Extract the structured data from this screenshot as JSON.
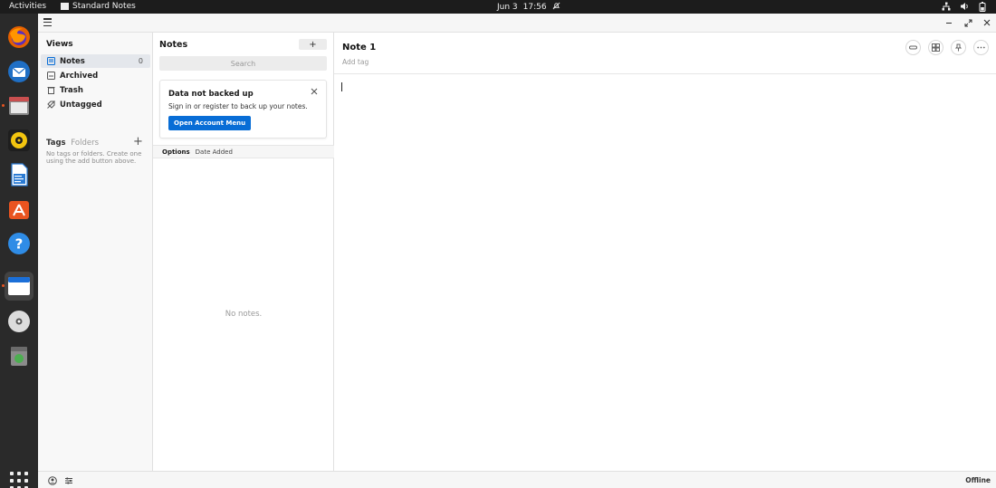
{
  "topbar": {
    "activities": "Activities",
    "app_name": "Standard Notes",
    "date": "Jun 3",
    "time": "17:56"
  },
  "dock": {
    "items": [
      "firefox-icon",
      "thunderbird-icon",
      "files-icon",
      "rhythmbox-icon",
      "writer-icon",
      "software-icon",
      "help-icon",
      "standard-notes-icon",
      "disc-icon",
      "trash-icon"
    ]
  },
  "views": {
    "heading": "Views",
    "items": [
      {
        "label": "Notes",
        "count": "0"
      },
      {
        "label": "Archived"
      },
      {
        "label": "Trash"
      },
      {
        "label": "Untagged"
      }
    ],
    "tags_label": "Tags",
    "folders_label": "Folders",
    "tags_empty": "No tags or folders. Create one using the add button above."
  },
  "notes": {
    "heading": "Notes",
    "add_label": "+",
    "search_placeholder": "Search",
    "backup": {
      "title": "Data not backed up",
      "description": "Sign in or register to back up your notes.",
      "button": "Open Account Menu"
    },
    "options_label": "Options",
    "sort_label": "Date Added",
    "empty_text": "No notes."
  },
  "editor": {
    "title": "Note 1",
    "add_tag": "Add tag"
  },
  "footer": {
    "status": "Offline"
  },
  "colors": {
    "accent": "#086dd6",
    "ubuntu_orange": "#e95420",
    "topbar": "#1c1c1c",
    "dock": "#2a2a2a"
  }
}
